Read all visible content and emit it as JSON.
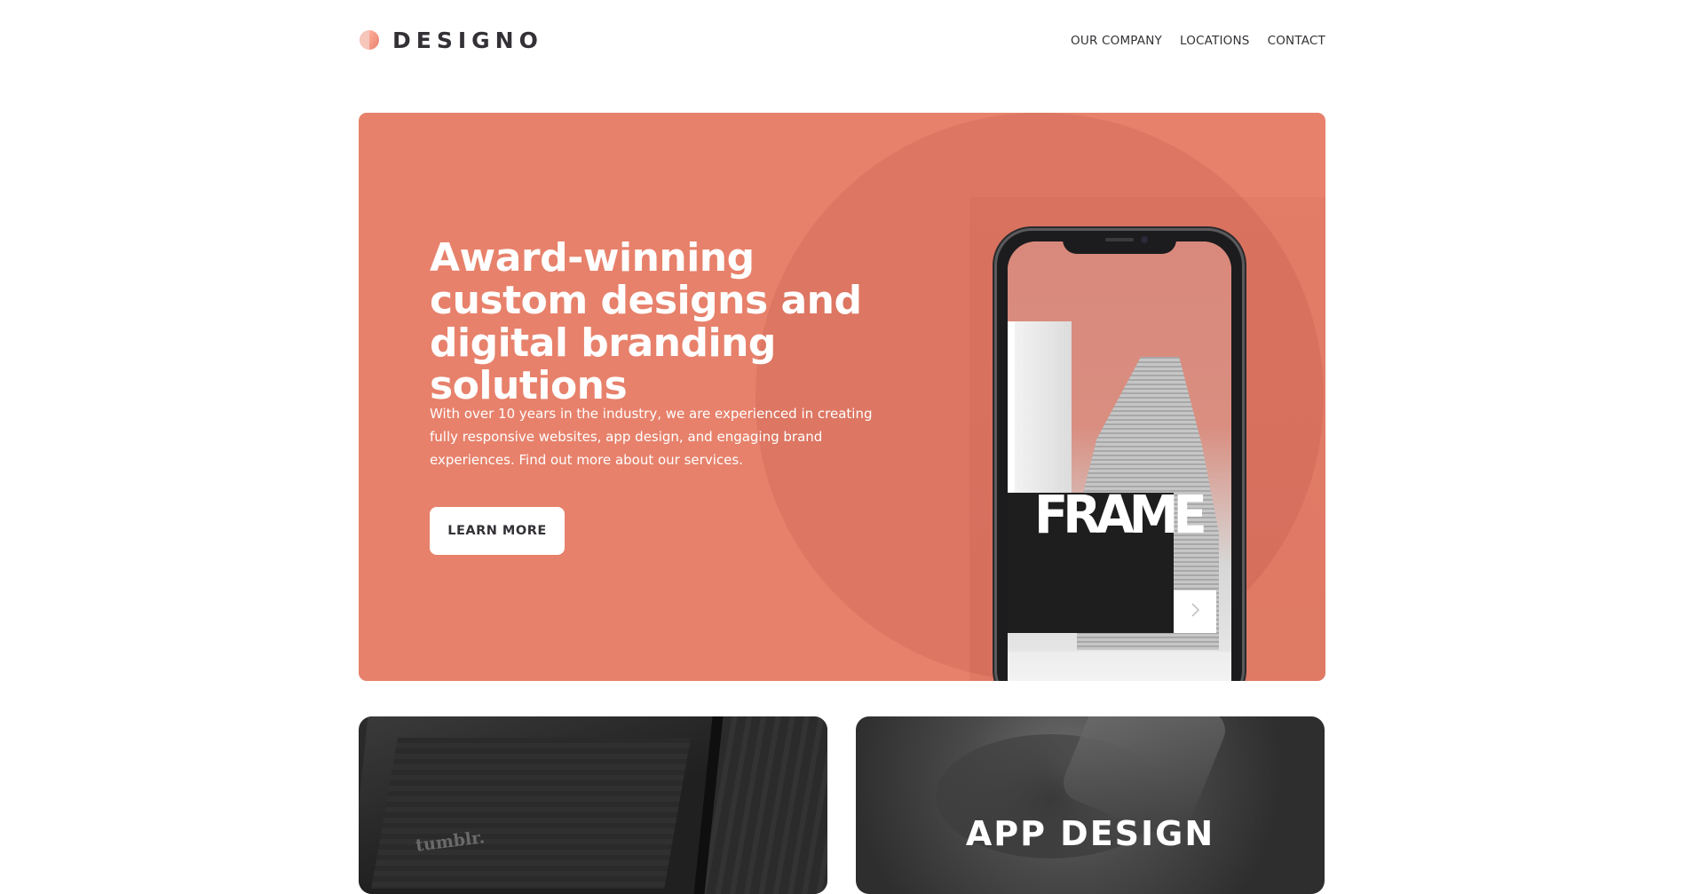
{
  "brand": {
    "name": "DESIGNO",
    "logo_icon": "half-circle-icon",
    "colors": {
      "peach": "#e7816b",
      "light_peach": "#ffad9b",
      "dark": "#333136",
      "white": "#ffffff"
    }
  },
  "nav": {
    "items": [
      {
        "label": "OUR COMPANY"
      },
      {
        "label": "LOCATIONS"
      },
      {
        "label": "CONTACT"
      }
    ]
  },
  "hero": {
    "title": "Award-winning custom designs and digital branding solutions",
    "text": "With over 10 years in the industry, we are experienced in creating fully responsive websites, app design, and engaging brand experiences. Find out more about our services.",
    "button_label": "LEARN MORE",
    "phone_screen": {
      "word": "FRAME",
      "next_icon": "chevron-right-icon"
    }
  },
  "cards": [
    {
      "title": "",
      "image_text": "tumblr."
    },
    {
      "title": "APP DESIGN"
    }
  ]
}
